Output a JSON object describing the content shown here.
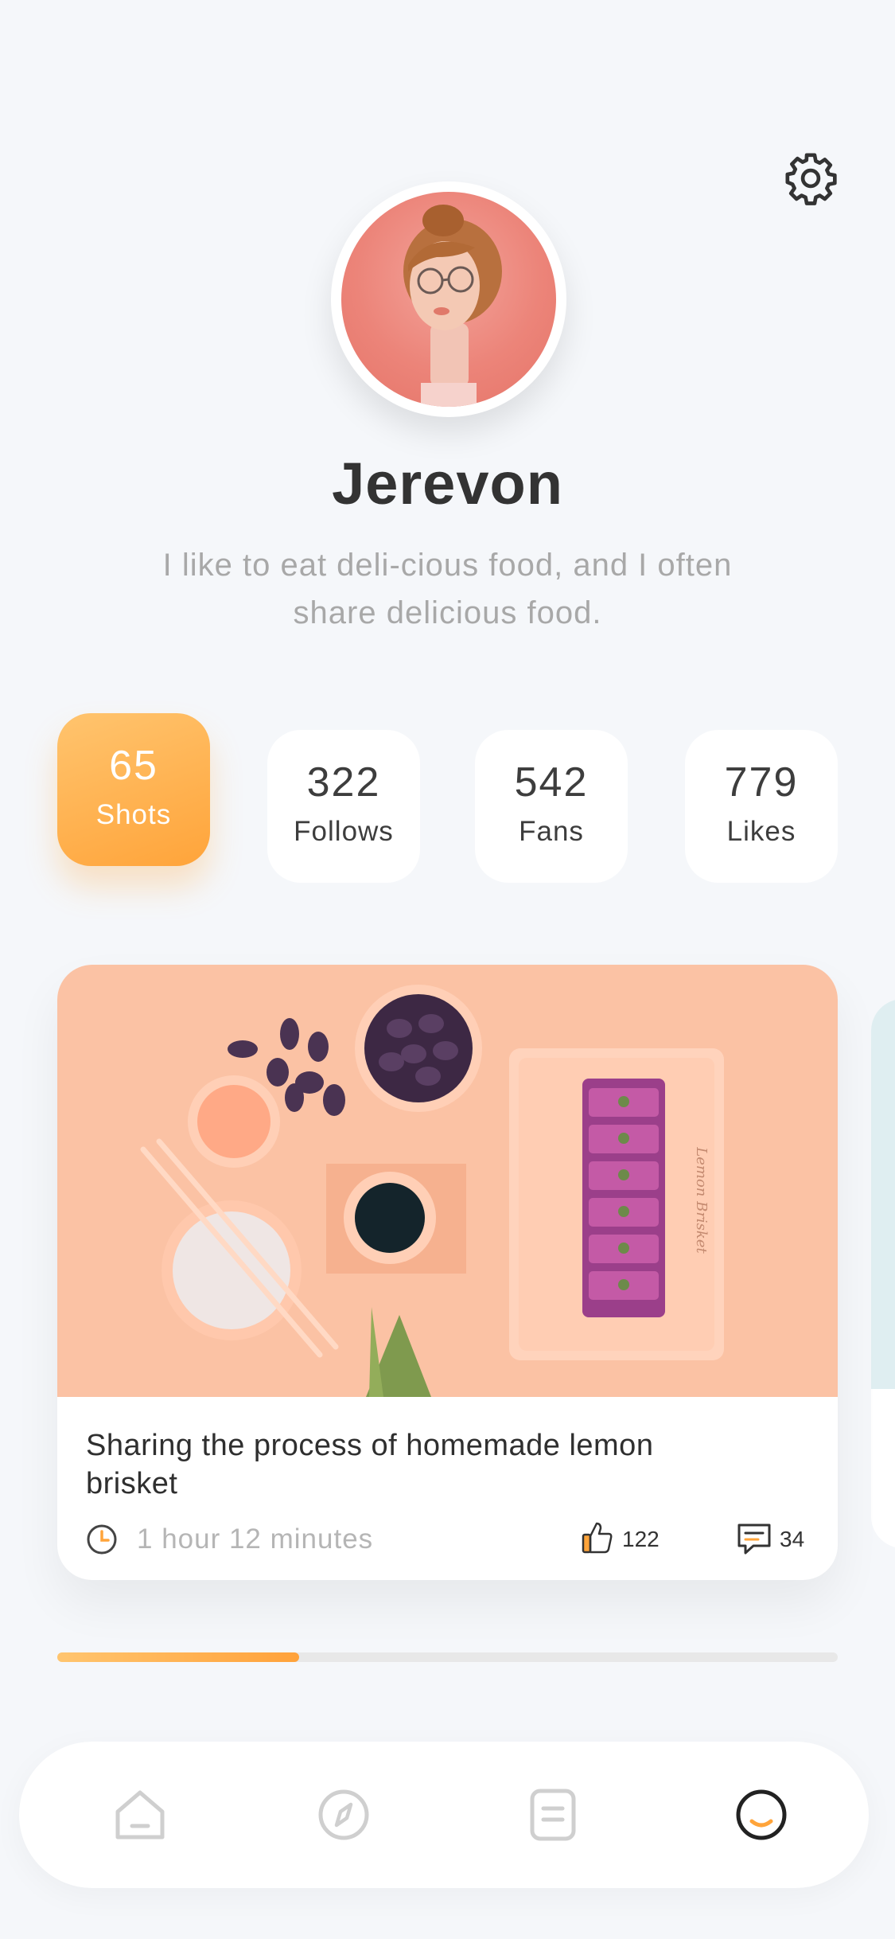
{
  "profile": {
    "name": "Jerevon",
    "bio": "I like to eat deli-cious food, and I often share delicious food."
  },
  "stats": [
    {
      "value": "65",
      "label": "Shots",
      "active": true
    },
    {
      "value": "322",
      "label": "Follows",
      "active": false
    },
    {
      "value": "542",
      "label": "Fans",
      "active": false
    },
    {
      "value": "779",
      "label": "Likes",
      "active": false
    }
  ],
  "post": {
    "title": "Sharing the process of homemade lemon brisket",
    "time": "1 hour 12 minutes",
    "likes": "122",
    "comments": "34",
    "image_text": "Lemon Brisket"
  },
  "progress": {
    "fraction": 0.31
  },
  "tabbar": {
    "tabs": [
      {
        "icon": "home-icon",
        "active": false
      },
      {
        "icon": "compass-icon",
        "active": false
      },
      {
        "icon": "notes-icon",
        "active": false
      },
      {
        "icon": "profile-icon",
        "active": true
      }
    ]
  },
  "colors": {
    "accent": "#ffa43a",
    "background": "#f5f7fa",
    "card_image_bg": "#fbc2a4"
  }
}
